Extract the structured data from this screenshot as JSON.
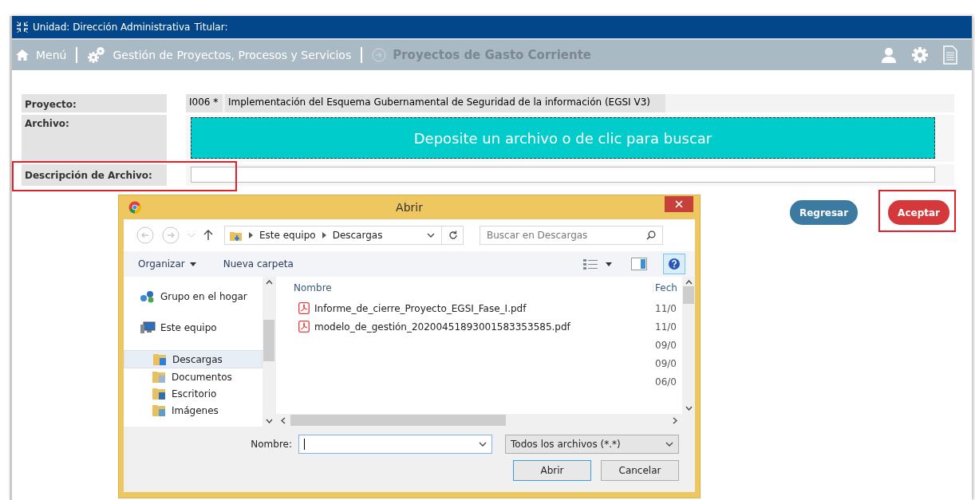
{
  "header": {
    "unit_label": "Unidad: Dirección Administrativa",
    "holder_label": "Titular:"
  },
  "nav": [
    {
      "kind": "home",
      "label": "Menú"
    },
    {
      "kind": "gears",
      "label": "Gestión de Proyectos, Procesos y Servicios"
    },
    {
      "kind": "current",
      "label": "Proyectos de Gasto Corriente"
    }
  ],
  "form": {
    "project_label": "Proyecto:",
    "project_code": "I006 *",
    "project_name": "Implementación del Esquema Gubernamental de Seguridad de la información (EGSI V3)",
    "file_label": "Archivo:",
    "dropzone_text": "Deposite un archivo o de clic para buscar",
    "description_label": "Descripción de Archivo:",
    "description_highlighted": true
  },
  "buttons": [
    {
      "kind": "secondary",
      "label": "Regresar",
      "highlighted": false
    },
    {
      "kind": "primary",
      "label": "Aceptar",
      "highlighted": true
    }
  ],
  "dialog": {
    "title": "Abrir",
    "breadcrumb": [
      "Este equipo",
      "Descargas"
    ],
    "search": {
      "placeholder": "Buscar en Descargas"
    },
    "toolbar": [
      "Organizar",
      "Nueva carpeta"
    ],
    "tree": [
      {
        "kind": "homegroup",
        "label": "Grupo en el hogar",
        "selected": false
      },
      {
        "kind": "computer",
        "label": "Este equipo",
        "selected": false,
        "children": [
          {
            "kind": "downloads",
            "label": "Descargas",
            "selected": true
          },
          {
            "kind": "documents",
            "label": "Documentos",
            "selected": false
          },
          {
            "kind": "desktop",
            "label": "Escritorio",
            "selected": false
          },
          {
            "kind": "pictures",
            "label": "Imágenes",
            "selected": false
          }
        ]
      }
    ],
    "columns": [
      "Nombre",
      "Fech"
    ],
    "files": [
      {
        "name": "Informe_de_cierre_Proyecto_EGSI_Fase_I.pdf",
        "date": "11/0"
      },
      {
        "name": "modelo_de_gestión_20200451893001583353585.pdf",
        "date": "11/0"
      },
      {
        "date": "09/0"
      },
      {
        "date": "09/0"
      },
      {
        "date": "06/0"
      }
    ],
    "filename_label": "Nombre:",
    "filetype": "Todos los archivos (*.*)",
    "actions": [
      "Abrir",
      "Cancelar"
    ]
  }
}
